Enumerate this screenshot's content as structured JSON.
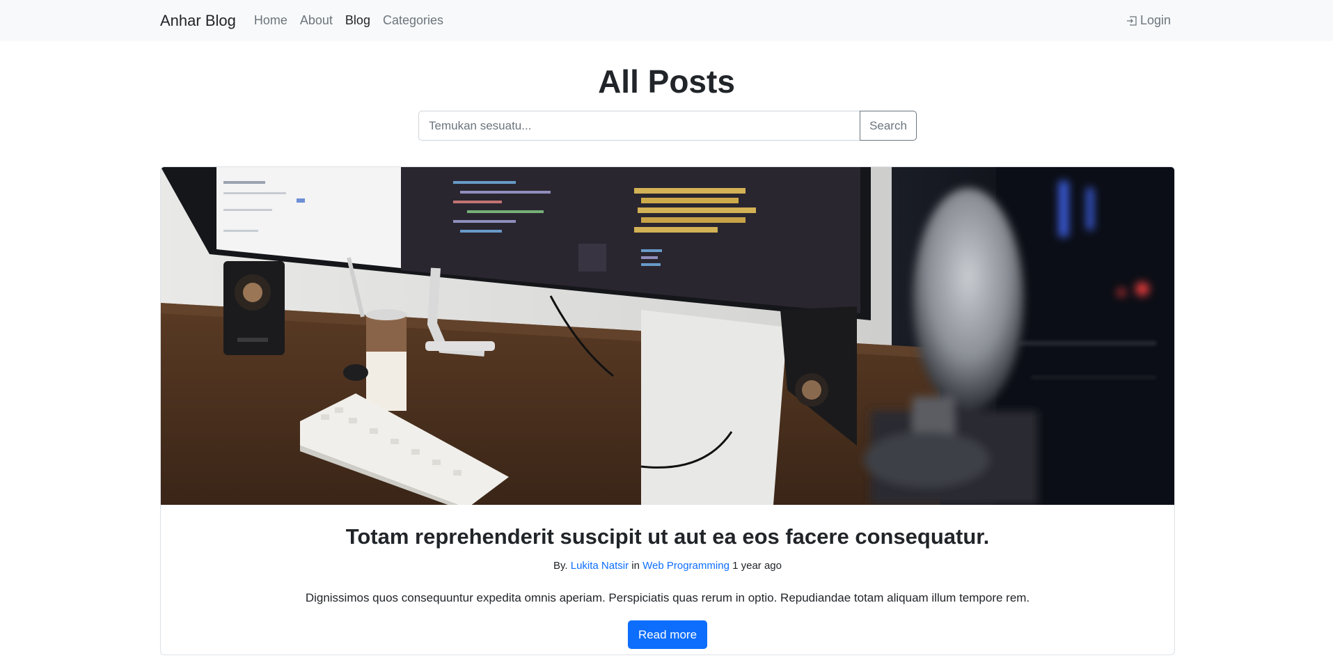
{
  "navbar": {
    "brand": "Anhar Blog",
    "links": [
      {
        "label": "Home",
        "active": false
      },
      {
        "label": "About",
        "active": false
      },
      {
        "label": "Blog",
        "active": true
      },
      {
        "label": "Categories",
        "active": false
      }
    ],
    "login_label": "Login",
    "login_icon": "login-icon"
  },
  "page": {
    "title": "All Posts"
  },
  "search": {
    "placeholder": "Temukan sesuatu...",
    "value": "",
    "button_label": "Search"
  },
  "featured_post": {
    "image": "desk-setup-photo",
    "title": "Totam reprehenderit suscipit ut aut ea eos facere consequatur.",
    "by_label": "By.",
    "author": "Lukita Natsir",
    "in_label": "in",
    "category": "Web Programming",
    "time_ago": "1 year ago",
    "excerpt": "Dignissimos quos consequuntur expedita omnis aperiam. Perspiciatis quas rerum in optio. Repudiandae totam aliquam illum tempore rem.",
    "button_label": "Read more"
  },
  "colors": {
    "primary": "#0d6efd",
    "navbar_bg": "#f8f9fa",
    "muted": "#6c757d"
  }
}
